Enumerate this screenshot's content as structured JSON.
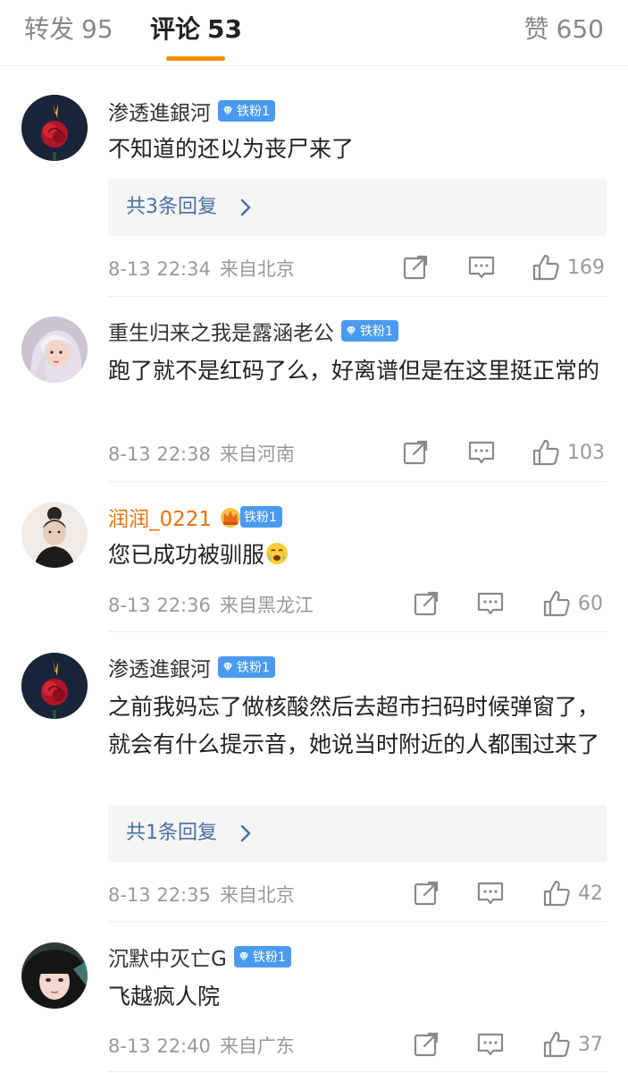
{
  "tabs": {
    "repost_label": "转发",
    "repost_count": "95",
    "comments_label": "评论",
    "comments_count": "53",
    "likes_label": "赞",
    "likes_count": "650"
  },
  "colors": {
    "accent": "#f78b00",
    "badge": "#4a9bf0",
    "reply_link": "#4a6fa5",
    "gold_name": "#e8730e"
  },
  "comments": [
    {
      "username": "渗透進銀河",
      "badge": "铁粉1",
      "text": "不知道的还以为丧尸来了",
      "replies": "共3条回复",
      "time": "8-13 22:34",
      "location": "来自北京",
      "likes": "169",
      "avatar_icon": "rose-avatar"
    },
    {
      "username": "重生归来之我是露涵老公",
      "badge": "铁粉1",
      "text": "跑了就不是红码了么，好离谱但是在这里挺正常的",
      "time": "8-13 22:38",
      "location": "来自河南",
      "likes": "103",
      "avatar_icon": "silver-hair-avatar"
    },
    {
      "username": "润润_0221",
      "badge": "铁粉1",
      "text": "您已成功被驯服",
      "time": "8-13 22:36",
      "location": "来自黑龙江",
      "likes": "60",
      "avatar_icon": "girl-bun-avatar",
      "emoji_icon": "crying-face-emoji",
      "name_icon": "crown-icon"
    },
    {
      "username": "渗透進銀河",
      "badge": "铁粉1",
      "text": "之前我妈忘了做核酸然后去超市扫码时候弹窗了，就会有什么提示音，她说当时附近的人都围过来了",
      "replies": "共1条回复",
      "time": "8-13 22:35",
      "location": "来自北京",
      "likes": "42",
      "avatar_icon": "rose-avatar"
    },
    {
      "username": "沉默中灭亡G",
      "badge": "铁粉1",
      "text": "飞越疯人院",
      "time": "8-13 22:40",
      "location": "来自广东",
      "likes": "37",
      "avatar_icon": "girl-bangs-avatar"
    }
  ]
}
